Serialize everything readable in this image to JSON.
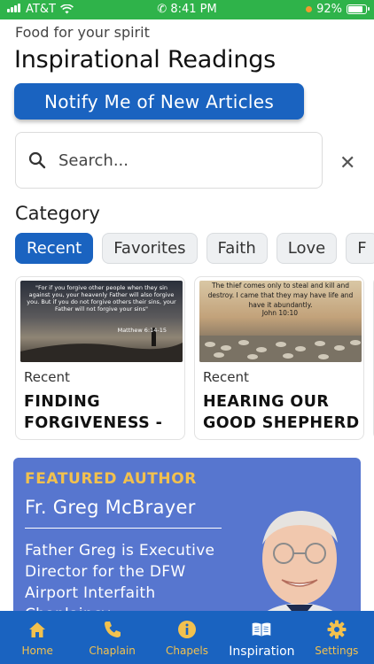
{
  "status_bar": {
    "carrier": "AT&T",
    "time": "8:41 PM",
    "battery": "92%",
    "battery_level": 0.92
  },
  "header": {
    "subtitle": "Food for your spirit",
    "title": "Inspirational Readings"
  },
  "notify_button": {
    "label": "Notify Me of New Articles"
  },
  "search": {
    "placeholder": "Search..."
  },
  "category": {
    "heading": "Category",
    "chips": [
      {
        "label": "Recent",
        "active": true
      },
      {
        "label": "Favorites",
        "active": false
      },
      {
        "label": "Faith",
        "active": false
      },
      {
        "label": "Love",
        "active": false
      },
      {
        "label": "F",
        "active": false
      }
    ]
  },
  "articles": [
    {
      "category": "Recent",
      "title": "FINDING FORGIVENESS -",
      "thumb_text": "\"For if you forgive other people when they sin against you, your heavenly Father will also forgive you. But if you do not forgive others their sins, your Father will not forgive your sins\"",
      "thumb_ref": "Matthew 6:14-15"
    },
    {
      "category": "Recent",
      "title": "HEARING OUR GOOD SHEPHERD",
      "thumb_text": "The thief comes only to steal and kill and destroy. I came that they may have life and have it abundantly.",
      "thumb_ref": "John 10:10"
    }
  ],
  "featured": {
    "label": "FEATURED AUTHOR",
    "name": "Fr. Greg McBrayer",
    "bio": "Father Greg is Executive Director for the DFW Airport Interfaith Chaplaincy"
  },
  "tabs": [
    {
      "label": "Home",
      "icon": "home-icon",
      "active": false
    },
    {
      "label": "Chaplain",
      "icon": "phone-icon",
      "active": false
    },
    {
      "label": "Chapels",
      "icon": "info-icon",
      "active": false
    },
    {
      "label": "Inspiration",
      "icon": "book-icon",
      "active": true
    },
    {
      "label": "Settings",
      "icon": "gear-icon",
      "active": false
    }
  ],
  "colors": {
    "brand_blue": "#1a63c0",
    "accent_gold": "#f2c14e",
    "featured_bg": "#5776cf",
    "status_green": "#2fb34a"
  }
}
